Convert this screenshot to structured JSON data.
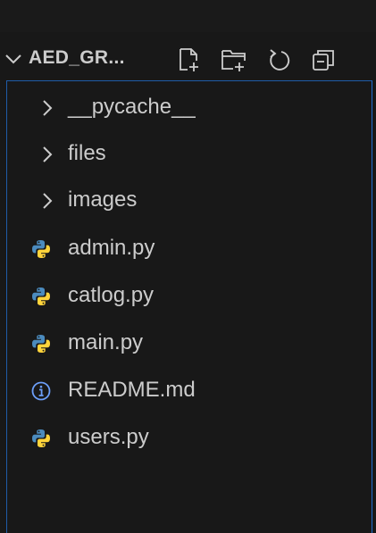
{
  "explorer": {
    "root_label": "AED_GR...",
    "actions": [
      {
        "name": "new-file",
        "icon": "new-file-icon"
      },
      {
        "name": "new-folder",
        "icon": "new-folder-icon"
      },
      {
        "name": "refresh",
        "icon": "refresh-icon"
      },
      {
        "name": "collapse-all",
        "icon": "collapse-all-icon"
      }
    ],
    "items": [
      {
        "label": "__pycache__",
        "kind": "folder",
        "icon": "chevron-right-icon"
      },
      {
        "label": "files",
        "kind": "folder",
        "icon": "chevron-right-icon"
      },
      {
        "label": "images",
        "kind": "folder",
        "icon": "chevron-right-icon"
      },
      {
        "label": "admin.py",
        "kind": "file",
        "icon": "python-icon"
      },
      {
        "label": "catlog.py",
        "kind": "file",
        "icon": "python-icon"
      },
      {
        "label": "main.py",
        "kind": "file",
        "icon": "python-icon"
      },
      {
        "label": "README.md",
        "kind": "file",
        "icon": "info-icon"
      },
      {
        "label": "users.py",
        "kind": "file",
        "icon": "python-icon"
      }
    ]
  },
  "colors": {
    "background": "#181818",
    "text": "#cccccc",
    "focus_border": "#1f5ca8",
    "python_blue": "#4b8bbe",
    "python_yellow": "#ffd43b",
    "info_blue": "#6c9ef8"
  }
}
